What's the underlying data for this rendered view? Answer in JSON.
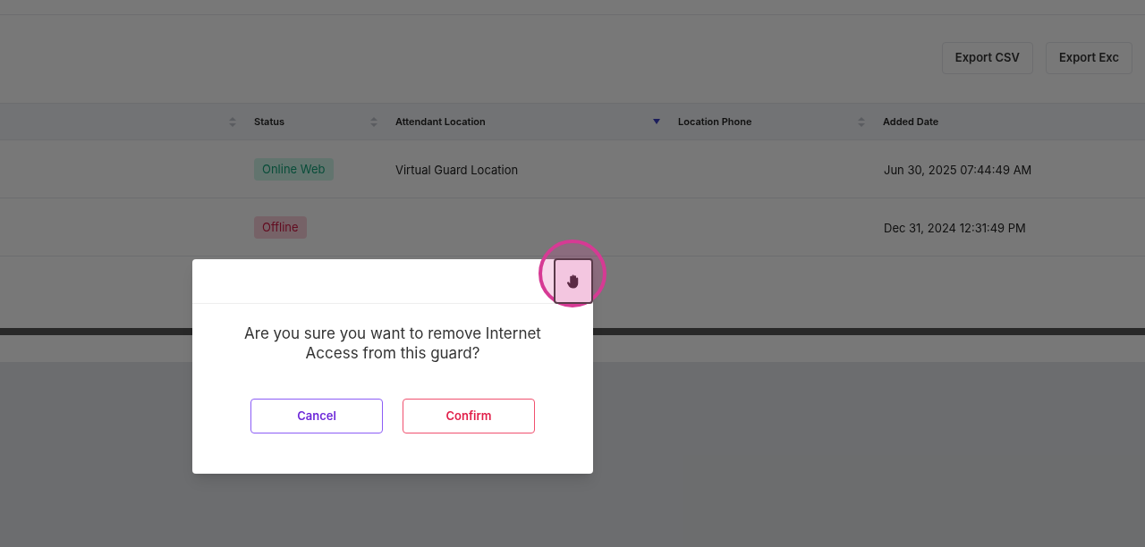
{
  "toolbar": {
    "buttons": [
      "Export CSV",
      "Export Exc"
    ]
  },
  "table": {
    "columns": [
      {
        "sorted": false
      },
      {
        "label": "Status",
        "sorted": false
      },
      {
        "label": "Attendant Location",
        "sorted": true
      },
      {
        "label": "Location Phone",
        "sorted": false
      },
      {
        "label": "Added Date"
      }
    ],
    "rows": [
      {
        "status": {
          "text": "Online Web",
          "kind": "online"
        },
        "attendant_location": "Virtual Guard Location",
        "added_date": "Jun 30, 2025 07:44:49 AM"
      },
      {
        "status": {
          "text": "Offline",
          "kind": "offline"
        },
        "added_date": "Dec 31, 2024 12:31:49 PM"
      }
    ]
  },
  "dialog": {
    "message": "Are you sure you want to remove Internet Access from this guard?",
    "buttons": [
      {
        "label": "Cancel",
        "kind": "cancel"
      },
      {
        "label": "Confirm",
        "kind": "confirm"
      }
    ]
  }
}
